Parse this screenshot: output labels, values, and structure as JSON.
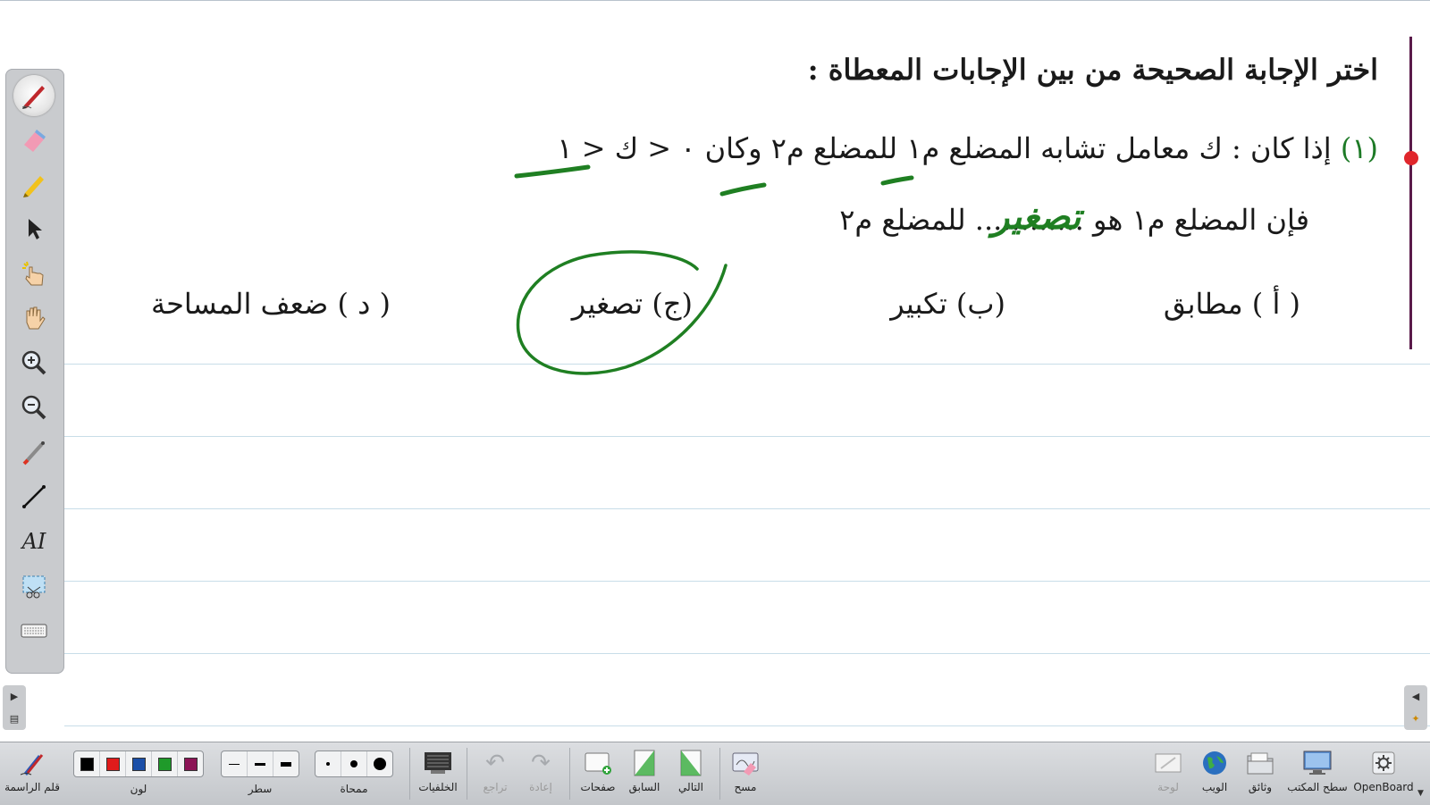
{
  "app": {
    "name": "OpenBoard"
  },
  "colors": {
    "ink_green": "#1f7f22",
    "margin_line": "#5a1a4a",
    "margin_dot": "#e0262c"
  },
  "page": {
    "title": "اختر الإجابة الصحيحة من بين الإجابات المعطاة :",
    "question1": {
      "number": "(١)",
      "line1": "إذا كان : ك معامل تشابه المضلع م١ للمضلع م٢ وكان ٠ < ك < ١",
      "line2": "فإن المضلع م١ هو ............ للمضلع م٢"
    },
    "options": {
      "a": "( أ ) مطابق",
      "b": "(ب) تكبير",
      "c": "(ج) تصغير",
      "d": "( د ) ضعف المساحة"
    }
  },
  "ink": {
    "answer_text": "تصغير"
  },
  "tool_palette": [
    {
      "name": "pen-tool",
      "icon": "pen-icon",
      "active": true
    },
    {
      "name": "eraser-tool",
      "icon": "eraser-icon"
    },
    {
      "name": "marker-tool",
      "icon": "highlighter-icon"
    },
    {
      "name": "selector-tool",
      "icon": "arrow-cursor-icon"
    },
    {
      "name": "interact-tool",
      "icon": "pointing-hand-icon"
    },
    {
      "name": "hand-tool",
      "icon": "hand-icon"
    },
    {
      "name": "zoom-in-tool",
      "icon": "zoom-in-icon"
    },
    {
      "name": "zoom-out-tool",
      "icon": "zoom-out-icon"
    },
    {
      "name": "laser-pointer-tool",
      "icon": "laser-pointer-icon"
    },
    {
      "name": "line-tool",
      "icon": "line-icon"
    },
    {
      "name": "text-tool",
      "icon": "text-icon",
      "glyph": "AI"
    },
    {
      "name": "capture-tool",
      "icon": "capture-icon"
    },
    {
      "name": "keyboard-tool",
      "icon": "keyboard-icon"
    }
  ],
  "bottom_bar": {
    "pen": {
      "label": "قلم الراسمة"
    },
    "color": {
      "label": "لون",
      "swatches": [
        "#000000",
        "#e01b1b",
        "#1b4fa8",
        "#1f9a2a",
        "#8c1456"
      ]
    },
    "line": {
      "label": "سطر"
    },
    "eraser": {
      "label": "ممحاة"
    },
    "backgrounds": {
      "label": "الخلفيات"
    },
    "undo": {
      "label": "تراجع"
    },
    "redo": {
      "label": "إعادة"
    },
    "pages": {
      "label": "صفحات"
    },
    "previous": {
      "label": "السابق"
    },
    "next": {
      "label": "التالي"
    },
    "clear": {
      "label": "مسح"
    },
    "board": {
      "label": "لوحة"
    },
    "web": {
      "label": "الويب"
    },
    "documents": {
      "label": "وثائق"
    },
    "desktop": {
      "label": "سطح المكتب"
    },
    "openboard": {
      "label": "OpenBoard"
    }
  }
}
